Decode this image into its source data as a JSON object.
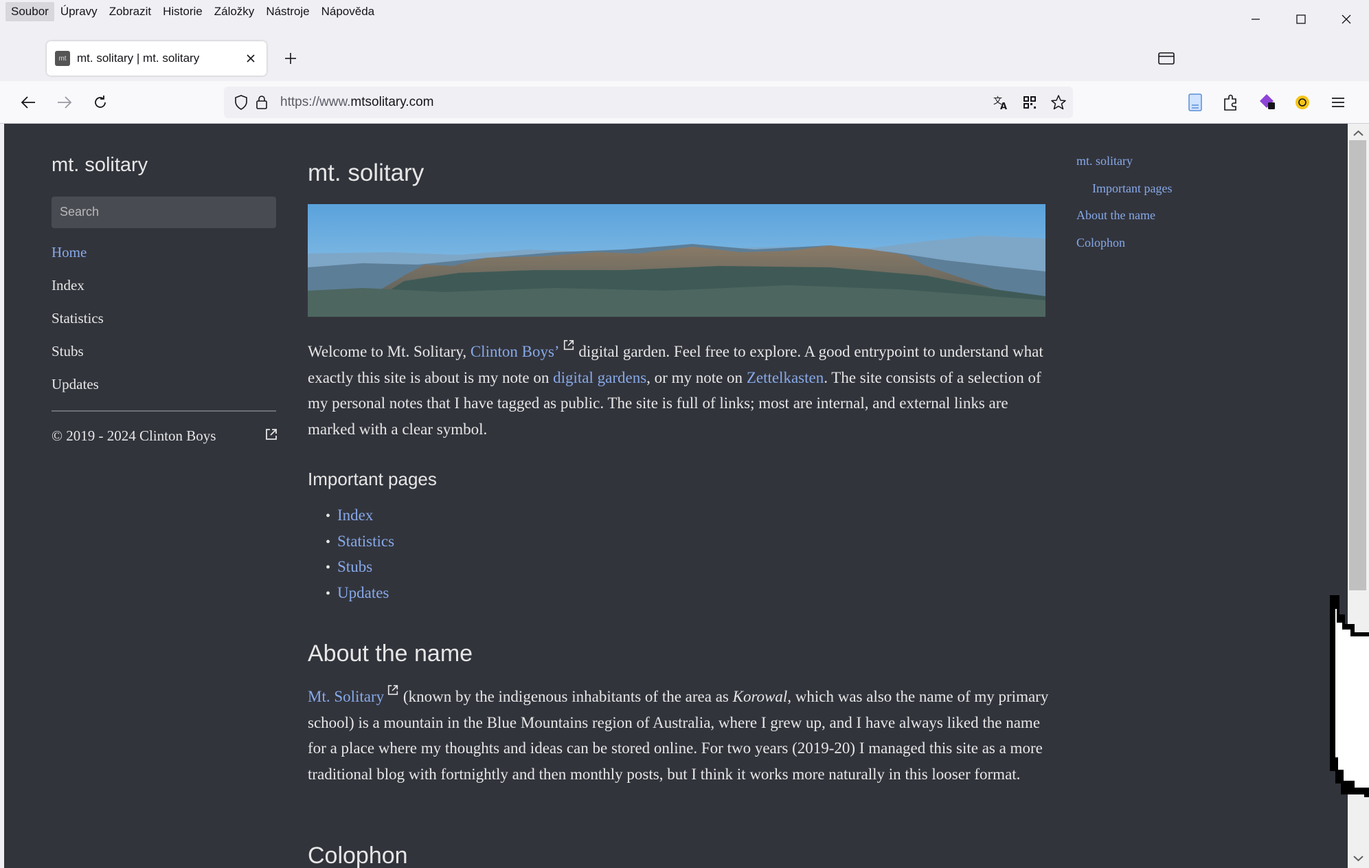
{
  "browser": {
    "menu": [
      "Soubor",
      "Úpravy",
      "Zobrazit",
      "Historie",
      "Záložky",
      "Nástroje",
      "Nápověda"
    ],
    "tab": {
      "favicon": "mt",
      "title": "mt. solitary | mt. solitary"
    },
    "url": {
      "prefix": "https://www.",
      "domain": "mtsolitary.com"
    }
  },
  "sidebar": {
    "site_title": "mt. solitary",
    "search_placeholder": "Search",
    "nav": [
      "Home",
      "Index",
      "Statistics",
      "Stubs",
      "Updates"
    ],
    "copyright": "© 2019 - 2024 Clinton Boys"
  },
  "main": {
    "title": "mt. solitary",
    "intro": {
      "t1": "Welcome to Mt. Solitary, ",
      "link1": "Clinton Boys’",
      "t2": " digital garden. Feel free to explore. A good entrypoint to understand what exactly this site is about is my note on ",
      "link2": "digital gardens",
      "t3": ", or my note on ",
      "link3": "Zettelkasten",
      "t4": ". The site consists of a selection of my personal notes that I have tagged as public. The site is full of links; most are internal, and external links are marked with a clear symbol."
    },
    "important_heading": "Important pages",
    "important_pages": [
      "Index",
      "Statistics",
      "Stubs",
      "Updates"
    ],
    "about_heading": "About the name",
    "about": {
      "link": "Mt. Solitary",
      "t1": " (known by the indigenous inhabitants of the area as ",
      "em": "Korowal",
      "t2": ", which was also the name of my primary school) is a mountain in the Blue Mountains region of Australia, where I grew up, and I have always liked the name for a place where my thoughts and ideas can be stored online. For two years (2019-20) I managed this site as a more traditional blog with fortnightly and then monthly posts, but I think it works more naturally in this looser format."
    },
    "colophon_heading": "Colophon"
  },
  "toc": [
    "mt. solitary",
    "Important pages",
    "About the name",
    "Colophon"
  ],
  "colors": {
    "page_bg": "#32343c",
    "link": "#86a9e8",
    "text": "#e6e6e6"
  }
}
